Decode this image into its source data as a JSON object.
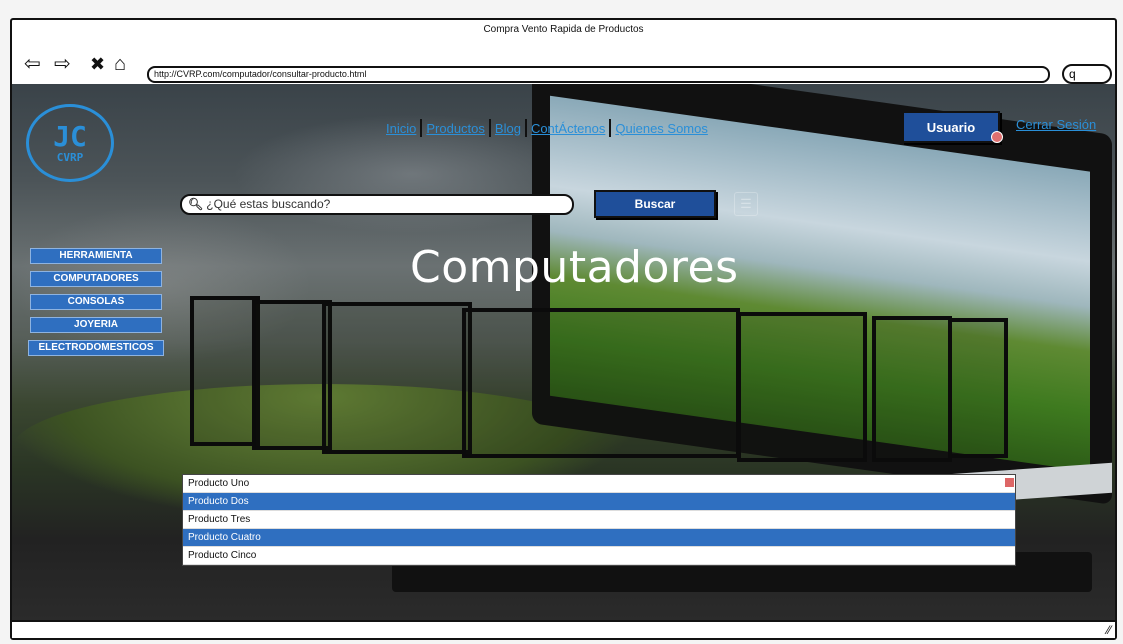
{
  "window": {
    "title": "Compra Vento Rapida de Productos"
  },
  "browser": {
    "url": "http://CVRP.com/computador/consultar-producto.html",
    "search_icon": "q"
  },
  "logo": {
    "mark": "JC",
    "text": "CVRP"
  },
  "topnav": {
    "items": [
      "Inicio",
      "Productos",
      "Blog",
      "ContÁctenos",
      "Quienes Somos"
    ]
  },
  "user": {
    "label": "Usuario",
    "logout": "Cerrar Sesión"
  },
  "search": {
    "placeholder": "¿Qué estas buscando?",
    "button": "Buscar"
  },
  "categories": [
    "HERRAMIENTA",
    "COMPUTADORES",
    "CONSOLAS",
    "JOYERIA",
    "ELECTRODOMESTICOS"
  ],
  "page_heading": "Computadores",
  "products": [
    {
      "name": "Producto Uno",
      "selected": false
    },
    {
      "name": "Producto Dos",
      "selected": true
    },
    {
      "name": "Producto Tres",
      "selected": false
    },
    {
      "name": "Producto Cuatro",
      "selected": true
    },
    {
      "name": "Producto Cinco",
      "selected": false
    }
  ],
  "colors": {
    "accent": "#2a8fd8",
    "button": "#1f4f9a",
    "selection": "#2f6fc0"
  }
}
